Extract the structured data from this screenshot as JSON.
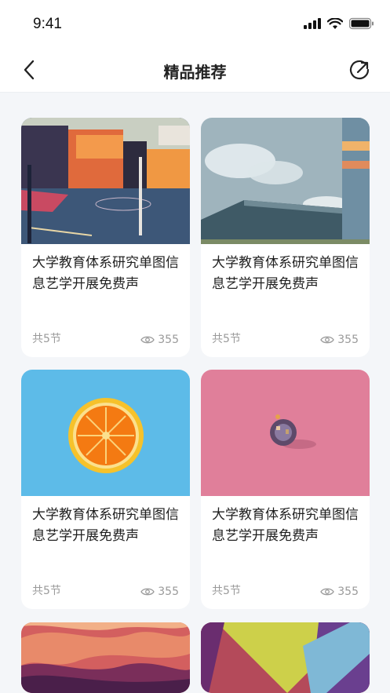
{
  "status_bar": {
    "time": "9:41"
  },
  "nav": {
    "title": "精品推荐"
  },
  "cards": [
    {
      "title": "大学教育体系研究单图信息艺学开展免费声",
      "lessons": "共5节",
      "views": "355",
      "image": "basketball-court-photo"
    },
    {
      "title": "大学教育体系研究单图信息艺学开展免费声",
      "lessons": "共5节",
      "views": "355",
      "image": "industrial-building-sky-photo"
    },
    {
      "title": "大学教育体系研究单图信息艺学开展免费声",
      "lessons": "共5节",
      "views": "355",
      "image": "orange-slice-photo"
    },
    {
      "title": "大学教育体系研究单图信息艺学开展免费声",
      "lessons": "共5节",
      "views": "355",
      "image": "tiny-planet-pink-photo"
    },
    {
      "title": "",
      "lessons": "",
      "views": "",
      "image": "canyon-photo"
    },
    {
      "title": "",
      "lessons": "",
      "views": "",
      "image": "abstract-triangles-photo"
    }
  ],
  "colors": {
    "background": "#f4f6f9",
    "card": "#ffffff",
    "muted_text": "#9a9a9a"
  }
}
